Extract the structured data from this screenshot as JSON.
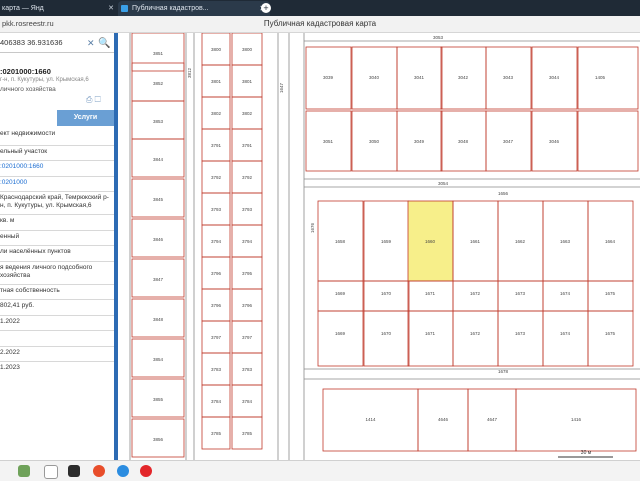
{
  "browser": {
    "tab1_title": "карта — Янд",
    "tab2_title": "Публичная кадастров...",
    "address": "pkk.rosreestr.ru",
    "page_title": "Публичная кадастровая карта"
  },
  "search": {
    "value": "406383 36.931636"
  },
  "card": {
    "number": ":0201000:1660",
    "address_short": "г-н, п. Кукутуры, ул. Крымская,6",
    "subtitle": "личного хозяйства",
    "tab_active": "Услуги",
    "rows": [
      {
        "text": "ект недвижимости",
        "link": false
      },
      {
        "text": "ельный участок",
        "link": false
      },
      {
        "text": ":0201000:1660",
        "link": true
      },
      {
        "text": ":0201000",
        "link": true
      },
      {
        "text": "Краснодарский край, Темрюкский р-н, п. Кукутуры, ул. Крымская,6",
        "link": false
      },
      {
        "text": "кв. м",
        "link": false
      },
      {
        "text": "енный",
        "link": false
      },
      {
        "text": "ли населённых пунктов",
        "link": false
      },
      {
        "text": "я ведения личного подсобного хозяйства",
        "link": false
      },
      {
        "text": "тная собственность",
        "link": false
      },
      {
        "text": "802,41 руб.",
        "link": false
      },
      {
        "text": "1.2022",
        "link": false
      },
      {
        "text": "2.2022",
        "link": false
      },
      {
        "text": "1.2023",
        "link": false
      }
    ]
  },
  "map": {
    "highlight_color": "#f7ef8a",
    "parcel_line_color": "#c0392b",
    "road_line_color": "#8a8a8a",
    "left_col_a": [
      "3851",
      "3852",
      "3853",
      "3844",
      "3845",
      "3846",
      "3847",
      "3848",
      "3854",
      "3855",
      "3856"
    ],
    "left_col_b_left": [
      "3800",
      "3801",
      "3802",
      "3791",
      "3792",
      "3793",
      "3794",
      "3796",
      "3796",
      "3797",
      "3783",
      "3784",
      "3785"
    ],
    "left_col_b_right": [
      "3800",
      "3801",
      "3802",
      "3791",
      "3792",
      "3793",
      "3794",
      "3795",
      "3796",
      "3797",
      "3783",
      "3784",
      "3785"
    ],
    "road_labels": [
      "3812",
      "1647",
      "1676",
      "3053",
      "3054",
      "1656",
      "1678"
    ],
    "top_row": [
      "3039",
      "3040",
      "3041",
      "3042",
      "3043",
      "3044",
      "1405"
    ],
    "second_row": [
      "3051",
      "3050",
      "3049",
      "3048",
      "3047",
      "3046"
    ],
    "block_row1": [
      "1658",
      "1659",
      "1660",
      "1661",
      "1662",
      "1663",
      "1664"
    ],
    "block_row2": [
      "1669",
      "1670",
      "1671",
      "1672",
      "1673",
      "1674",
      "1675"
    ],
    "block_row3": [
      "1669",
      "1670",
      "1671",
      "1672",
      "1673",
      "1674",
      "1675"
    ],
    "bottom_row": [
      "1414",
      "4646",
      "4647",
      "1416"
    ],
    "scale_label": "30 м"
  }
}
